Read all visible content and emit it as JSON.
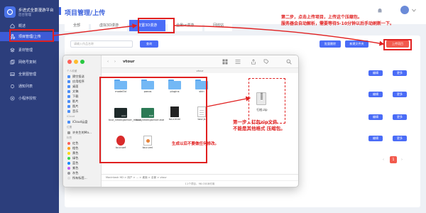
{
  "app": {
    "brand_name": "步进式全景漫游平台",
    "brand_sub": "后台管理",
    "page_title": "项目管理/上传"
  },
  "sidebar": {
    "items": [
      {
        "label": "概述",
        "icon": "home-icon"
      },
      {
        "label": "项目管理/上传",
        "icon": "project-icon",
        "active": true
      },
      {
        "label": "素材管理",
        "icon": "material-icon"
      },
      {
        "label": "网络号复制",
        "icon": "copy-icon"
      },
      {
        "label": "全景图管理",
        "icon": "panorama-icon"
      },
      {
        "label": "通知列表",
        "icon": "bell-icon"
      },
      {
        "label": "小程序授权",
        "icon": "miniapp-icon"
      }
    ]
  },
  "tabs": [
    {
      "label": "全部"
    },
    {
      "label": "虚拟3D漫游"
    },
    {
      "label": "安置3D漫游",
      "active": true
    },
    {
      "label": "全景vr漫游"
    },
    {
      "label": "回收站"
    }
  ],
  "toolbar": {
    "search_placeholder": "请输入作品名称",
    "search_button": "查询",
    "batch_delete": "批量删除",
    "new_folder": "新建文件夹",
    "upload": "上传项目"
  },
  "rows": {
    "edit_label": "编辑",
    "more_label": "更多"
  },
  "pagination": {
    "current": "1"
  },
  "finder": {
    "title": "vtour",
    "column_header": "vtour",
    "sidebar_sections": [
      {
        "heading": "个人收藏",
        "items": [
          "隔空投送",
          "应用程序",
          "桌面",
          "文稿",
          "下载",
          "影片",
          "图片",
          "音乐"
        ]
      },
      {
        "heading": "iCloud",
        "items": [
          "iCloud云盘"
        ]
      },
      {
        "heading": "位置",
        "items": [
          "许先生的Ma..."
        ]
      },
      {
        "heading": "标签",
        "items": [
          "红色",
          "橙色",
          "黄色",
          "绿色",
          "蓝色",
          "紫色",
          "灰色",
          "所有标签..."
        ]
      }
    ],
    "files": [
      {
        "name": "model3d",
        "kind": "folder"
      },
      {
        "name": "panos",
        "kind": "folder"
      },
      {
        "name": "plugins",
        "kind": "folder"
      },
      {
        "name": "skin",
        "kind": "folder"
      },
      {
        "name": "tour_testingserver_macos",
        "kind": "exe-dark"
      },
      {
        "name": "tour_testingserver.exe",
        "kind": "exe-green"
      },
      {
        "name": "tour.html",
        "kind": "doc-dark"
      },
      {
        "name": "tour.js",
        "kind": "doc"
      },
      {
        "name": "tour.swf",
        "kind": "swf"
      },
      {
        "name": "tour.xml",
        "kind": "xml"
      }
    ],
    "path": "Macintosh HD > 用户 > ... > 桌面 > 全景 > vtour",
    "status": "11个项目，98.03GB可用"
  },
  "zip": {
    "label": "归档.zip"
  },
  "annotations": {
    "step2_line1": "第二步，点击上传项目，上传这个压缩包。",
    "step2_line2": "服务器会自动解析，需要等待5-10分钟以后手动刷新一下。",
    "step1_line1": "第一步，打包zip文件",
    "step1_line2": "不能是其他格式 压缩包。",
    "generated_note": "生成以后不要做任何修改。"
  },
  "colors": {
    "sidebar": "#2c3e7c",
    "accent": "#4a6cf7",
    "annotation": "#e02020",
    "upload_button": "#f25a4d"
  }
}
